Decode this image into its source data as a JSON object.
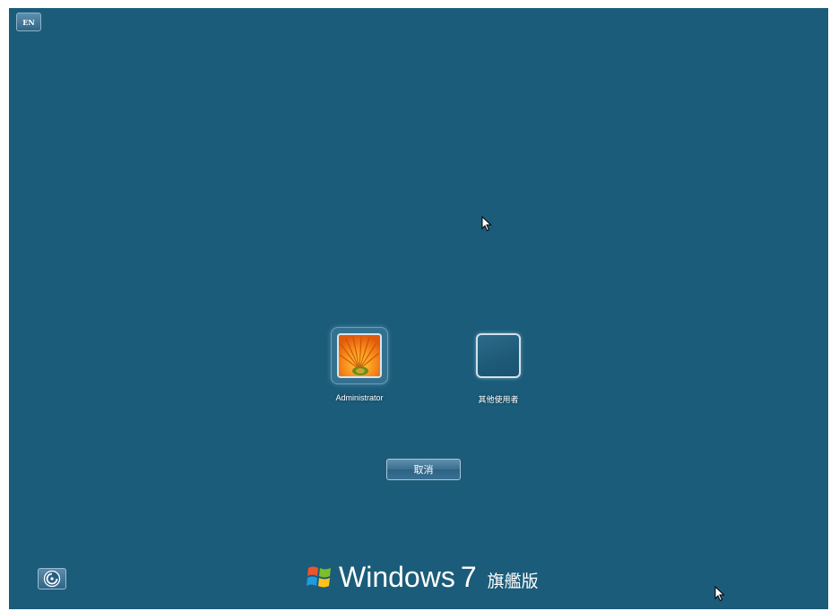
{
  "language_bar": {
    "label": "EN"
  },
  "users": [
    {
      "name": "Administrator",
      "avatar": "orange-flower-avatar"
    },
    {
      "name": "其他使用者",
      "avatar": "blank-user-tile"
    }
  ],
  "buttons": {
    "cancel_label": "取消",
    "ease_of_access_icon": "ease-of-access-icon"
  },
  "branding": {
    "name": "Windows",
    "version": "7",
    "edition": "旗艦版",
    "logo_icon": "windows-flag-icon"
  },
  "colors": {
    "background": "#1b5c7a",
    "text": "#ffffff",
    "avatar_orange": "#f47a10"
  }
}
